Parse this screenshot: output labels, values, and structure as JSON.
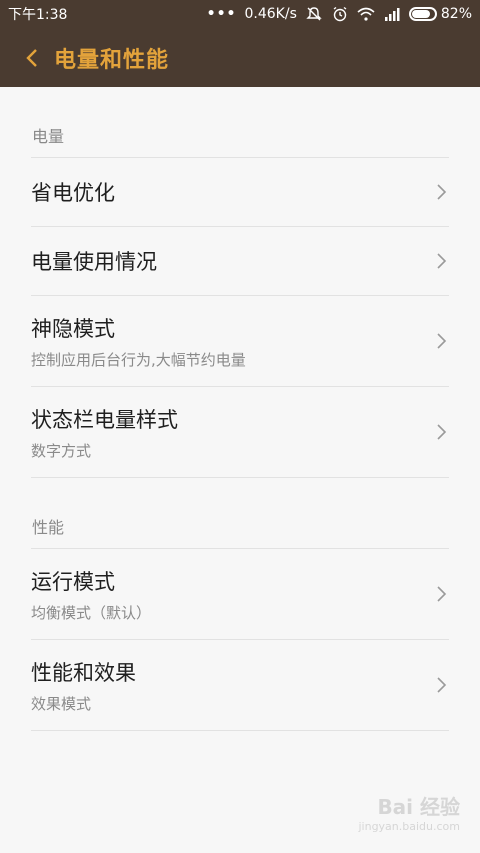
{
  "status": {
    "time": "下午1:38",
    "dots": "•••",
    "speed": "0.46K/s",
    "battery_pct": "82%",
    "battery_level": 0.82
  },
  "appbar": {
    "title": "电量和性能"
  },
  "sections": {
    "power": {
      "header": "电量",
      "items": [
        {
          "title": "省电优化",
          "sub": ""
        },
        {
          "title": "电量使用情况",
          "sub": ""
        },
        {
          "title": "神隐模式",
          "sub": "控制应用后台行为,大幅节约电量"
        },
        {
          "title": "状态栏电量样式",
          "sub": "数字方式"
        }
      ]
    },
    "perf": {
      "header": "性能",
      "items": [
        {
          "title": "运行模式",
          "sub": "均衡模式（默认）"
        },
        {
          "title": "性能和效果",
          "sub": "效果模式"
        }
      ]
    }
  },
  "watermark": {
    "logo": "Bai 经验",
    "url": "jingyan.baidu.com"
  },
  "colors": {
    "bar": "#4a3b30",
    "accent": "#e3a33b",
    "bg": "#f7f7f7"
  }
}
